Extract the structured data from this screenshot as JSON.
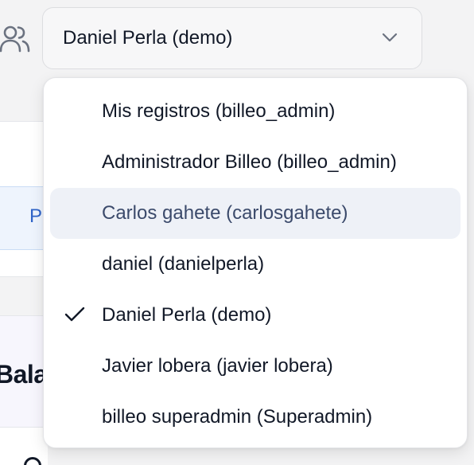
{
  "user_selector": {
    "icon": "users-icon",
    "selected_label": "Daniel Perla (demo)",
    "chevron_icon": "chevron-down-icon"
  },
  "dropdown": {
    "options": [
      {
        "label": "Mis registros (billeo_admin)",
        "selected": false,
        "highlighted": false
      },
      {
        "label": "Administrador Billeo (billeo_admin)",
        "selected": false,
        "highlighted": false
      },
      {
        "label": "Carlos gahete (carlosgahete)",
        "selected": false,
        "highlighted": true
      },
      {
        "label": "daniel (danielperla)",
        "selected": false,
        "highlighted": false
      },
      {
        "label": "Daniel Perla (demo)",
        "selected": true,
        "highlighted": false
      },
      {
        "label": "Javier lobera (javier lobera)",
        "selected": false,
        "highlighted": false
      },
      {
        "label": "billeo superadmin (Superadmin)",
        "selected": false,
        "highlighted": false
      }
    ],
    "check_icon": "check-icon"
  },
  "background": {
    "partial_tab_text": "P",
    "partial_heading": "Bala"
  },
  "colors": {
    "highlight_bg": "#eef1f7",
    "accent_blue": "#2f64c8",
    "page_bg": "#f3f3f4"
  }
}
